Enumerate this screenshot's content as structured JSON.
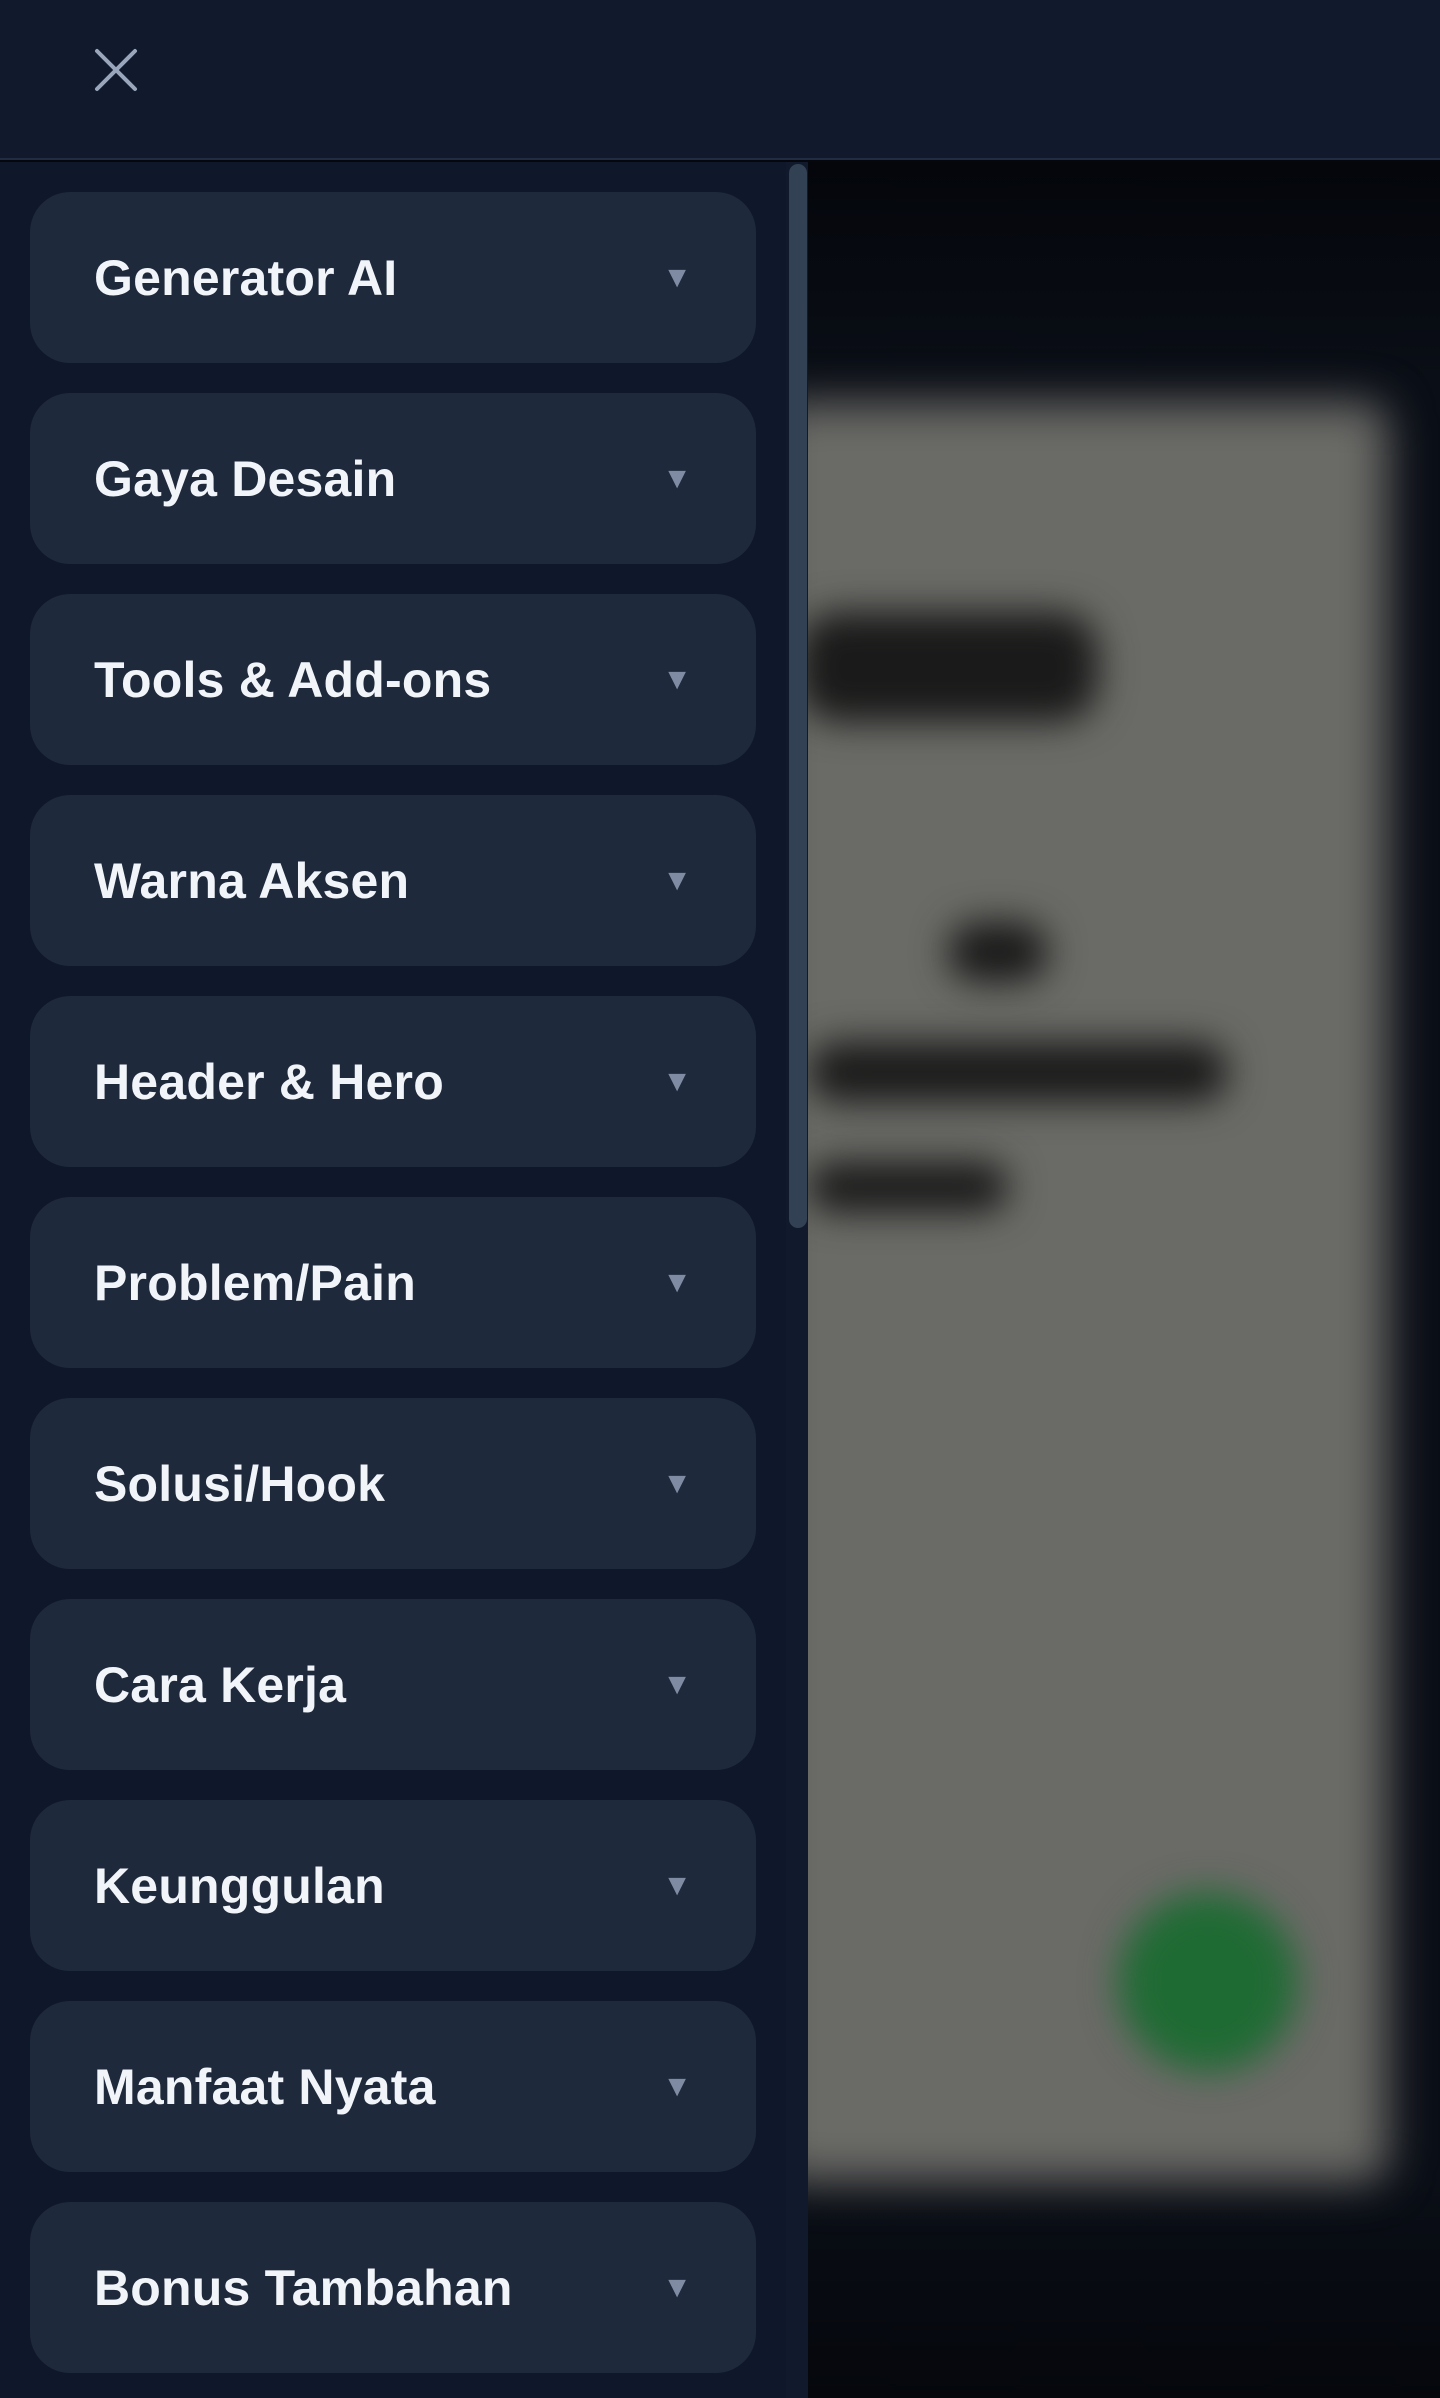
{
  "header": {
    "close_icon": "close-icon"
  },
  "menu": {
    "items": [
      {
        "label": "Generator AI"
      },
      {
        "label": "Gaya Desain"
      },
      {
        "label": "Tools & Add-ons"
      },
      {
        "label": "Warna Aksen"
      },
      {
        "label": "Header & Hero"
      },
      {
        "label": "Problem/Pain"
      },
      {
        "label": "Solusi/Hook"
      },
      {
        "label": "Cara Kerja"
      },
      {
        "label": "Keunggulan"
      },
      {
        "label": "Manfaat Nyata"
      },
      {
        "label": "Bonus Tambahan"
      }
    ],
    "caret": "▼",
    "caret_icon": "caret-down-icon"
  },
  "colors": {
    "topbar_bg": "#111a2d",
    "sidebar_bg": "#0f172a",
    "item_bg": "#1e293b",
    "item_text": "#f1f5f9",
    "caret": "#7f8ba3",
    "scroll_thumb": "#334155"
  }
}
